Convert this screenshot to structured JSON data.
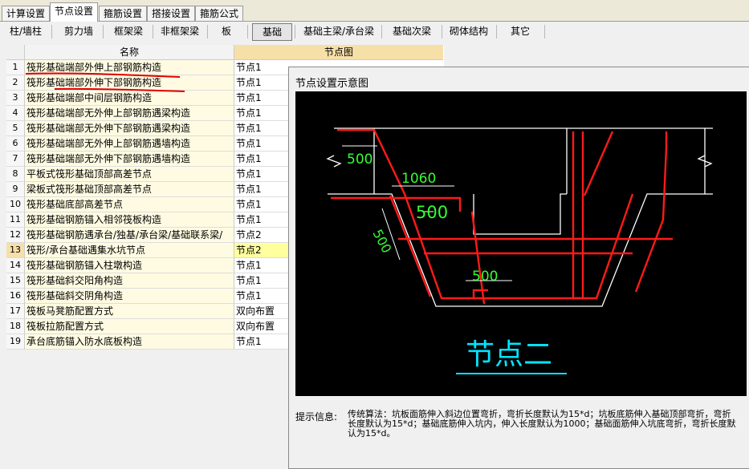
{
  "tabs": [
    {
      "label": "计算设置",
      "active": false
    },
    {
      "label": "节点设置",
      "active": true
    },
    {
      "label": "箍筋设置",
      "active": false
    },
    {
      "label": "搭接设置",
      "active": false
    },
    {
      "label": "箍筋公式",
      "active": false
    }
  ],
  "toolbar": [
    {
      "label": "柱/墙柱",
      "active": false
    },
    {
      "label": "剪力墙",
      "active": false
    },
    {
      "label": "框架梁",
      "active": false
    },
    {
      "label": "非框架梁",
      "active": false
    },
    {
      "label": "板",
      "active": false
    },
    {
      "label": "基础",
      "active": true
    },
    {
      "label": "基础主梁/承台梁",
      "active": false
    },
    {
      "label": "基础次梁",
      "active": false
    },
    {
      "label": "砌体结构",
      "active": false
    },
    {
      "label": "其它",
      "active": false
    }
  ],
  "grid": {
    "header_name": "名称",
    "header_node": "节点图",
    "rows": [
      {
        "num": "1",
        "name": "筏形基础端部外伸上部钢筋构造",
        "node": "节点1"
      },
      {
        "num": "2",
        "name": "筏形基础端部外伸下部钢筋构造",
        "node": "节点1"
      },
      {
        "num": "3",
        "name": "筏形基础端部中间层钢筋构造",
        "node": "节点1"
      },
      {
        "num": "4",
        "name": "筏形基础端部无外伸上部钢筋遇梁构造",
        "node": "节点1"
      },
      {
        "num": "5",
        "name": "筏形基础端部无外伸下部钢筋遇梁构造",
        "node": "节点1"
      },
      {
        "num": "6",
        "name": "筏形基础端部无外伸上部钢筋遇墙构造",
        "node": "节点1"
      },
      {
        "num": "7",
        "name": "筏形基础端部无外伸下部钢筋遇墙构造",
        "node": "节点1"
      },
      {
        "num": "8",
        "name": "平板式筏形基础顶部高差节点",
        "node": "节点1"
      },
      {
        "num": "9",
        "name": "梁板式筏形基础顶部高差节点",
        "node": "节点1"
      },
      {
        "num": "10",
        "name": "筏形基础底部高差节点",
        "node": "节点1"
      },
      {
        "num": "11",
        "name": "筏形基础钢筋锚入相邻筏板构造",
        "node": "节点1"
      },
      {
        "num": "12",
        "name": "筏形基础钢筋遇承台/独基/承台梁/基础联系梁/",
        "node": "节点2"
      },
      {
        "num": "13",
        "name": "筏形/承台基础遇集水坑节点",
        "node": "节点2"
      },
      {
        "num": "14",
        "name": "筏形基础钢筋锚入柱墩构造",
        "node": "节点1"
      },
      {
        "num": "15",
        "name": "筏形基础斜交阳角构造",
        "node": "节点1"
      },
      {
        "num": "16",
        "name": "筏形基础斜交阴角构造",
        "node": "节点1"
      },
      {
        "num": "17",
        "name": "筏板马凳筋配置方式",
        "node": "双向布置"
      },
      {
        "num": "18",
        "name": "筏板拉筋配置方式",
        "node": "双向布置"
      },
      {
        "num": "19",
        "name": "承台底筋锚入防水底板构造",
        "node": "节点1"
      }
    ],
    "selected_row": "13"
  },
  "preview": {
    "title": "节点设置示意图",
    "caption": "节点二",
    "dims": [
      "500",
      "1060",
      "500",
      "500",
      "500"
    ],
    "hint_label": "提示信息:",
    "hint_text": "传统算法：坑板面筋伸入斜边位置弯折，弯折长度默认为15*d；坑板底筋伸入基础顶部弯折，弯折长度默认为15*d；基础底筋伸入坑内，伸入长度默认为1000；基础面筋伸入坑底弯折，弯折长度默认为15*d。"
  },
  "colors": {
    "rebar": "#ff1a1a",
    "concrete": "#ffffff",
    "dim": "#33ff33",
    "caption": "#00e5ff",
    "selected_row": "#ffff9e",
    "header_node": "#f7dfa8"
  }
}
